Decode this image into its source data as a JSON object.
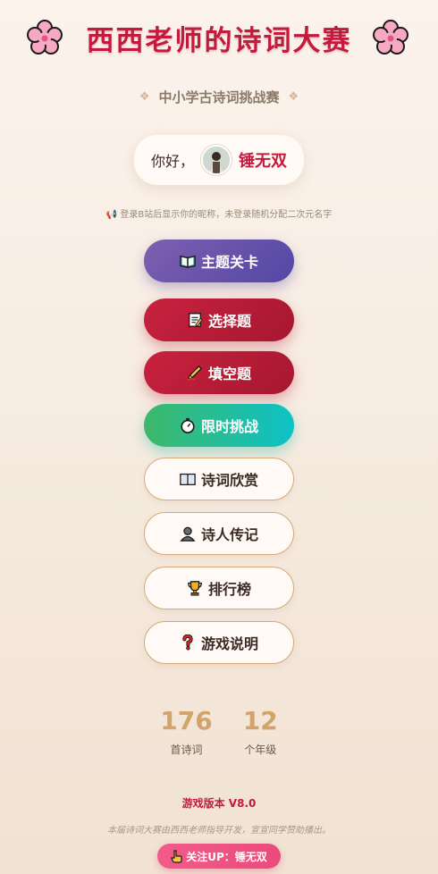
{
  "header": {
    "title": "西西老师的诗词大赛",
    "left_icon": "cherry-blossom-icon",
    "right_icon": "cherry-blossom-icon"
  },
  "subtitle": {
    "text": "中小学古诗词挑战赛",
    "ornament": "❖"
  },
  "greeting": {
    "prefix": "你好，",
    "name": "锤无双",
    "avatar_icon": "user-avatar"
  },
  "hint": {
    "icon": "📢",
    "text": "登录B站后显示你的昵称，未登录随机分配二次元名字"
  },
  "menu": [
    {
      "label": "主题关卡",
      "icon": "open-book-icon",
      "style": "purple"
    },
    {
      "label": "选择题",
      "icon": "memo-icon",
      "style": "red"
    },
    {
      "label": "填空题",
      "icon": "pencil-icon",
      "style": "red"
    },
    {
      "label": "限时挑战",
      "icon": "stopwatch-icon",
      "style": "green"
    },
    {
      "label": "诗词欣赏",
      "icon": "book-icon",
      "style": "white"
    },
    {
      "label": "诗人传记",
      "icon": "person-icon",
      "style": "white"
    },
    {
      "label": "排行榜",
      "icon": "trophy-icon",
      "style": "white"
    },
    {
      "label": "游戏说明",
      "icon": "question-icon",
      "style": "white"
    }
  ],
  "stats": [
    {
      "value": "176",
      "label": "首诗词"
    },
    {
      "value": "12",
      "label": "个年级"
    }
  ],
  "footer": {
    "version": "游戏版本 V8.0",
    "credit": "本届诗词大赛由西西老师指导开发，宣宣同学赞助播出。",
    "follow_label": "关注UP：锤无双",
    "follow_icon": "pointing-hand-icon"
  },
  "colors": {
    "accent": "#c41a3e",
    "gold": "#d2a46c",
    "background": "#f6ebe0"
  }
}
